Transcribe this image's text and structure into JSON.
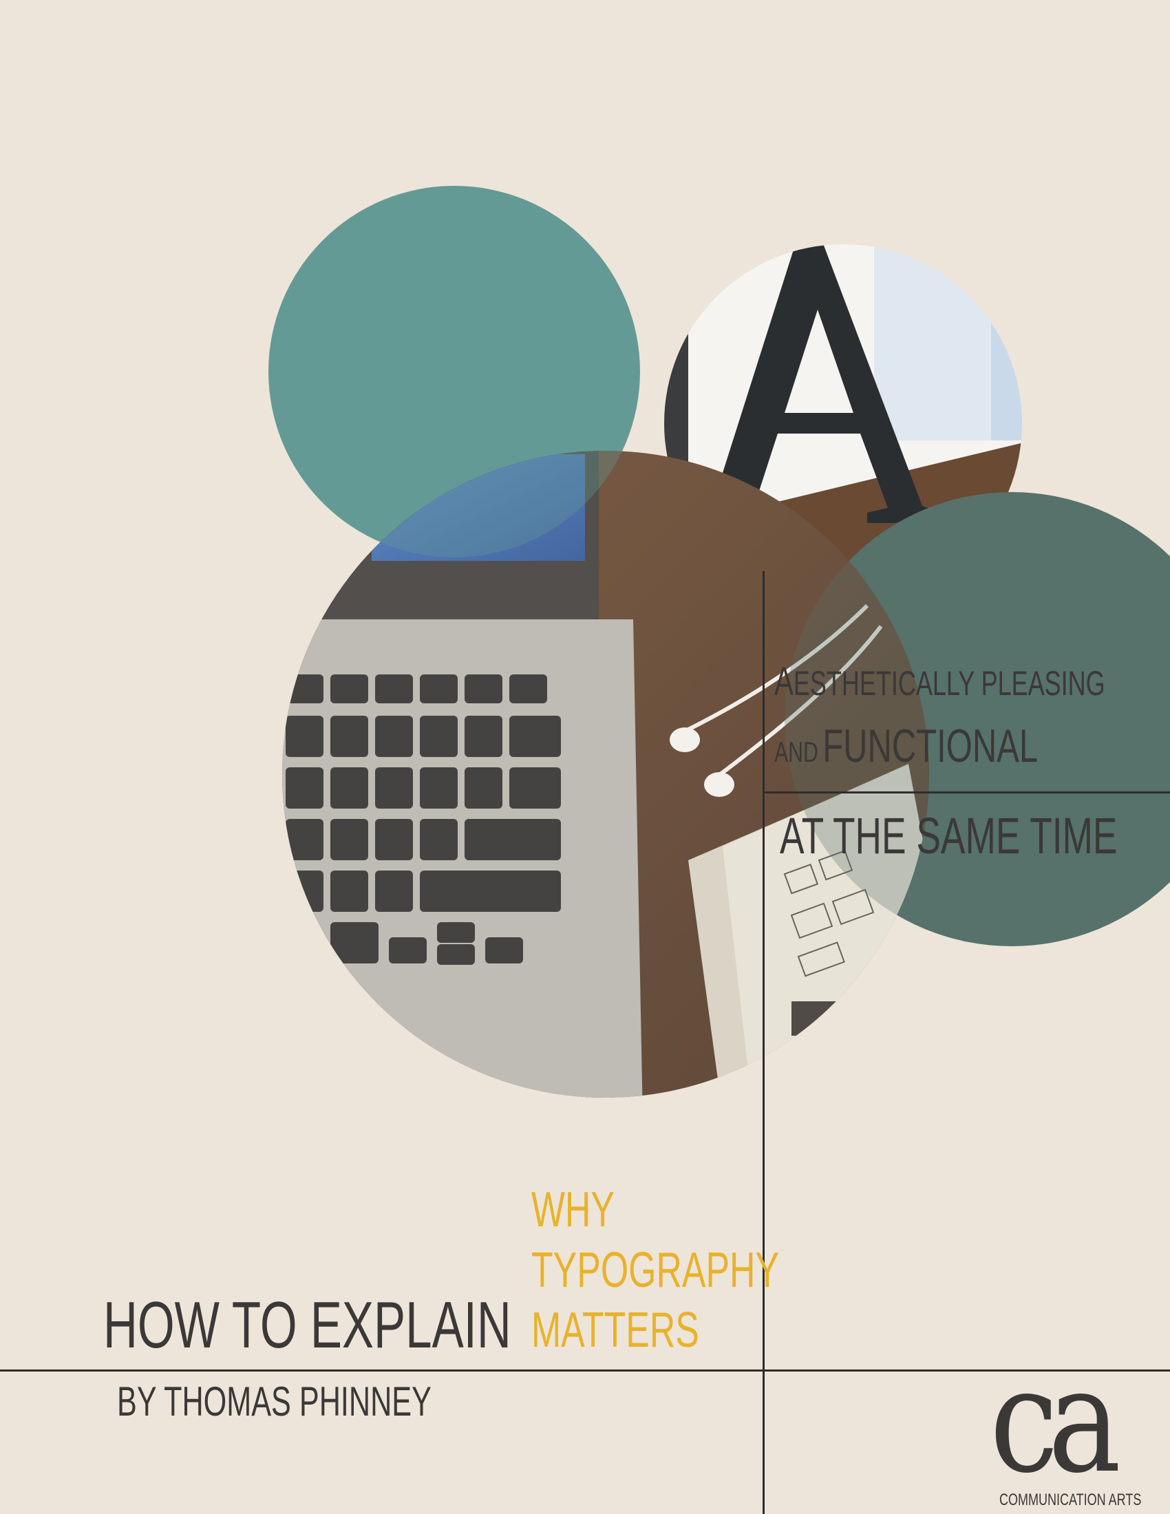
{
  "colors": {
    "background": "#ede5d9",
    "teal": "#649a95",
    "dark_teal": "#57716b",
    "accent": "#e9b22c",
    "text": "#3b3838"
  },
  "tagline": {
    "line1_big": "A",
    "line1_rest": "ESTHETICALLY PLEASING",
    "line2_small": "AND",
    "line2_big": "FUNCTIONAL",
    "line3": "AT THE SAME TIME"
  },
  "title": {
    "why": "WHY",
    "typography": "TYPOGRAPHY",
    "matters": "MATTERS",
    "how": "HOW TO EXPLAIN",
    "byline": "BY THOMAS PHINNEY"
  },
  "logo": {
    "mark": "ca",
    "text": "COMMUNICATION ARTS"
  },
  "icons": {
    "photo_letter": "letter-a-photo",
    "photo_laptop": "laptop-keyboard-photo"
  }
}
